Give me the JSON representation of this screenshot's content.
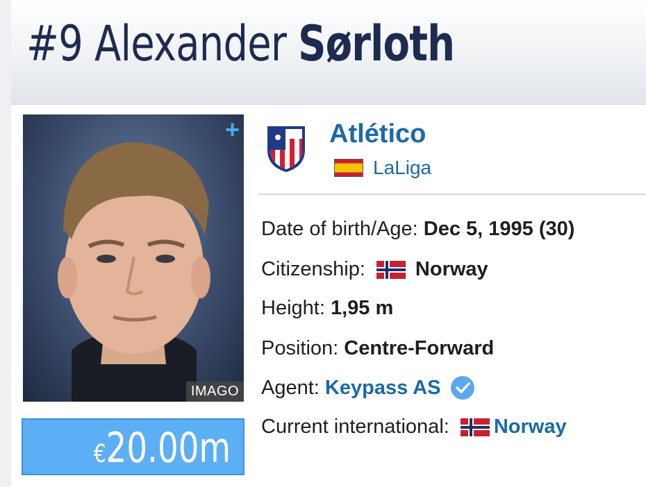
{
  "header": {
    "number": "#9",
    "first_name": "Alexander",
    "last_name": "Sørloth"
  },
  "photo": {
    "credit": "IMAGO",
    "expand_icon": "plus-icon"
  },
  "market_value": {
    "currency": "€",
    "amount": "20.00m",
    "bg_color": "#5caff5"
  },
  "club": {
    "name": "Atlético",
    "crest_icon": "atletico-crest-icon",
    "league": "LaLiga",
    "league_flag_icon": "spain-flag-icon"
  },
  "details": {
    "dob_label": "Date of birth/Age:",
    "dob_value": "Dec 5, 1995 (30)",
    "citizenship_label": "Citizenship:",
    "citizenship_value": "Norway",
    "height_label": "Height:",
    "height_value": "1,95 m",
    "position_label": "Position:",
    "position_value": "Centre-Forward",
    "agent_label": "Agent:",
    "agent_value": "Keypass AS",
    "agent_verified_icon": "verified-check-icon",
    "international_label": "Current international:",
    "international_value": "Norway"
  },
  "colors": {
    "title": "#1d2b4f",
    "link": "#1b6aa5",
    "verified": "#5aa9ef"
  }
}
